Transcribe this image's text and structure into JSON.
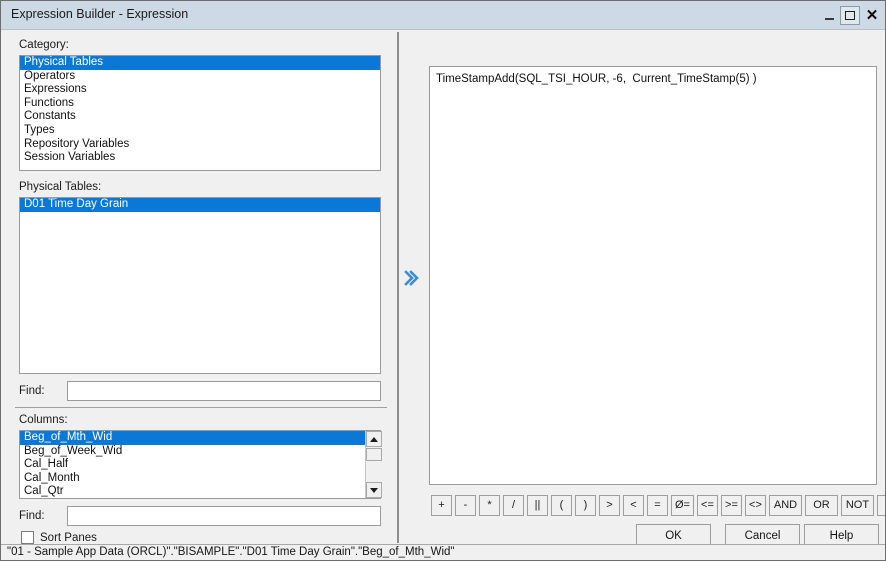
{
  "window": {
    "title": "Expression Builder - Expression",
    "controls": {
      "minimize": "–",
      "maximize": "□",
      "close": "✕"
    }
  },
  "left_pane": {
    "category_label": "Category:",
    "category_items": [
      "Physical Tables",
      "Operators",
      "Expressions",
      "Functions",
      "Constants",
      "Types",
      "Repository Variables",
      "Session Variables"
    ],
    "category_selected": "Physical Tables",
    "physical_tables_label": "Physical Tables:",
    "physical_tables_items": [
      "D01 Time Day Grain"
    ],
    "physical_tables_selected": "D01 Time Day Grain",
    "find_label_top": "Find:",
    "find_value_top": "",
    "find_placeholder_top": "",
    "columns_label": "Columns:",
    "columns_items": [
      "Beg_of_Mth_Wid",
      "Beg_of_Week_Wid",
      "Cal_Half",
      "Cal_Month",
      "Cal_Qtr"
    ],
    "columns_selected": "Beg_of_Mth_Wid",
    "find_label_bottom": "Find:",
    "find_value_bottom": "",
    "find_placeholder_bottom": "",
    "sort_panes_label": "Sort Panes",
    "sort_panes_checked": false
  },
  "insert_button": {
    "icon": "double-chevron-right",
    "glyph": "»",
    "color": "#3a8fd4"
  },
  "expression": {
    "text": "TimeStampAdd(SQL_TSI_HOUR, -6,  Current_TimeStamp(5) )"
  },
  "operators": [
    {
      "label": "+",
      "name": "plus",
      "wide": false
    },
    {
      "label": "-",
      "name": "minus",
      "wide": false
    },
    {
      "label": "*",
      "name": "multiply",
      "wide": false
    },
    {
      "label": "/",
      "name": "divide",
      "wide": false
    },
    {
      "label": "||",
      "name": "concat",
      "wide": false
    },
    {
      "label": "(",
      "name": "paren-open",
      "wide": false
    },
    {
      "label": ")",
      "name": "paren-close",
      "wide": false
    },
    {
      "label": ">",
      "name": "greater-than",
      "wide": false
    },
    {
      "label": "<",
      "name": "less-than",
      "wide": false
    },
    {
      "label": "=",
      "name": "equals",
      "wide": false
    },
    {
      "label": "Ø=",
      "name": "not-equals",
      "wide": false
    },
    {
      "label": "<=",
      "name": "less-or-equal",
      "wide": false
    },
    {
      "label": ">=",
      "name": "greater-or-equal",
      "wide": false
    },
    {
      "label": "<>",
      "name": "diamond-not-equal",
      "wide": false
    },
    {
      "label": "AND",
      "name": "and",
      "wide": true
    },
    {
      "label": "OR",
      "name": "or",
      "wide": true
    },
    {
      "label": "NOT",
      "name": "not",
      "wide": true
    },
    {
      "label": ",",
      "name": "comma",
      "wide": false
    }
  ],
  "actions": {
    "ok": "OK",
    "cancel": "Cancel",
    "help": "Help"
  },
  "statusbar": {
    "text": "\"01 - Sample App Data (ORCL)\".\"BISAMPLE\".\"D01 Time Day Grain\".\"Beg_of_Mth_Wid\""
  },
  "colors": {
    "titlebar": "#cdd9e5",
    "selection": "#0a78d7",
    "dialog": "#f0f0f0",
    "field": "#ffffff",
    "accent": "#3a8fd4"
  }
}
